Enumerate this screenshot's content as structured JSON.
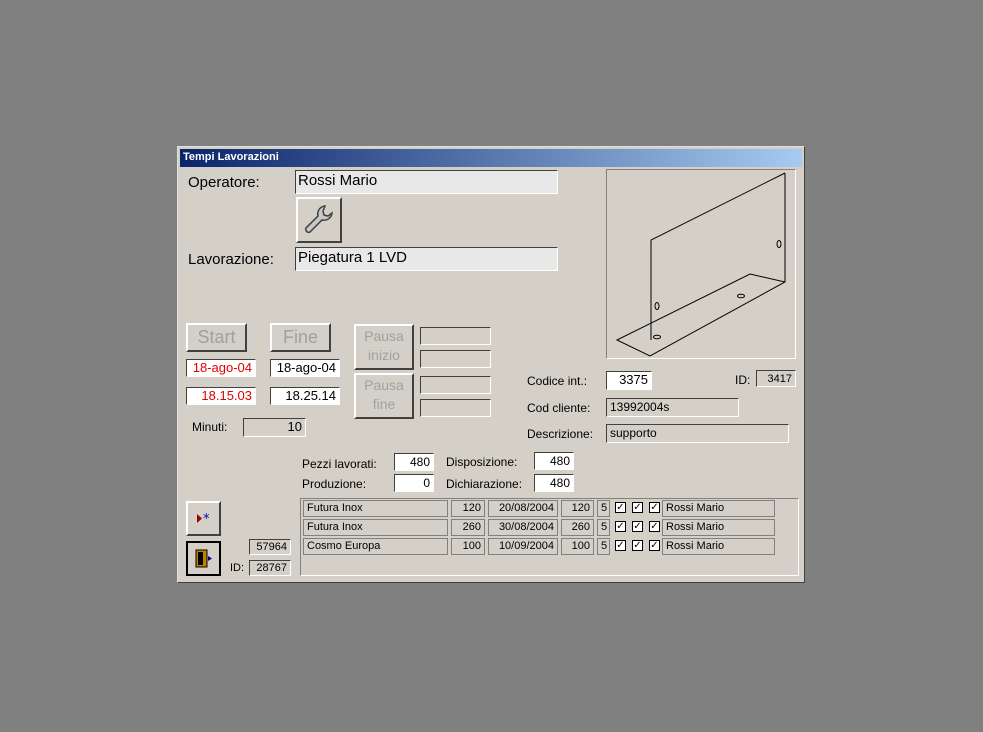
{
  "window": {
    "title": "Tempi Lavorazioni"
  },
  "operatore": {
    "label": "Operatore:",
    "value": "Rossi Mario"
  },
  "lavorazione": {
    "label": "Lavorazione:",
    "value": "Piegatura 1 LVD"
  },
  "tool_button": {
    "icon": "wrench-icon"
  },
  "start": {
    "label": "Start",
    "date": "18-ago-04",
    "time": "18.15.03"
  },
  "fine": {
    "label": "Fine",
    "date": "18-ago-04",
    "time": "18.25.14"
  },
  "pausa_inizio": {
    "line1": "Pausa",
    "line2": "inizio",
    "field1": "",
    "field2": ""
  },
  "pausa_fine": {
    "line1": "Pausa",
    "line2": "fine",
    "field1": "",
    "field2": ""
  },
  "minuti": {
    "label": "Minuti:",
    "value": "10"
  },
  "codice_int": {
    "label": "Codice  int.:",
    "value": "3375"
  },
  "id_top": {
    "label": "ID:",
    "value": "3417"
  },
  "cod_cliente": {
    "label": "Cod cliente:",
    "value": "13992004s"
  },
  "descrizione": {
    "label": "Descrizione:",
    "value": "supporto"
  },
  "pezzi_lavorati": {
    "label": "Pezzi lavorati:",
    "value": "480"
  },
  "produzione": {
    "label": "Produzione:",
    "value": "0"
  },
  "disposizione": {
    "label": "Disposizione:",
    "value": "480"
  },
  "dichiarazione": {
    "label": "Dichiarazione:",
    "value": "480"
  },
  "bottom_left": {
    "value1": "57964",
    "id_label": "ID:",
    "value2": "28767"
  },
  "rows": [
    {
      "cliente": "Futura Inox",
      "qta": "120",
      "data": "20/08/2004",
      "qta2": "120",
      "n": "5",
      "c1": true,
      "c2": true,
      "c3": true,
      "operatore": "Rossi Mario"
    },
    {
      "cliente": "Futura Inox",
      "qta": "260",
      "data": "30/08/2004",
      "qta2": "260",
      "n": "5",
      "c1": true,
      "c2": true,
      "c3": true,
      "operatore": "Rossi Mario"
    },
    {
      "cliente": "Cosmo Europa",
      "qta": "100",
      "data": "10/09/2004",
      "qta2": "100",
      "n": "5",
      "c1": true,
      "c2": true,
      "c3": true,
      "operatore": "Rossi Mario"
    }
  ],
  "colors": {
    "title_start": "#0a246a",
    "title_end": "#a6caf0",
    "red_text": "#e00000",
    "face": "#d4d0c8"
  }
}
